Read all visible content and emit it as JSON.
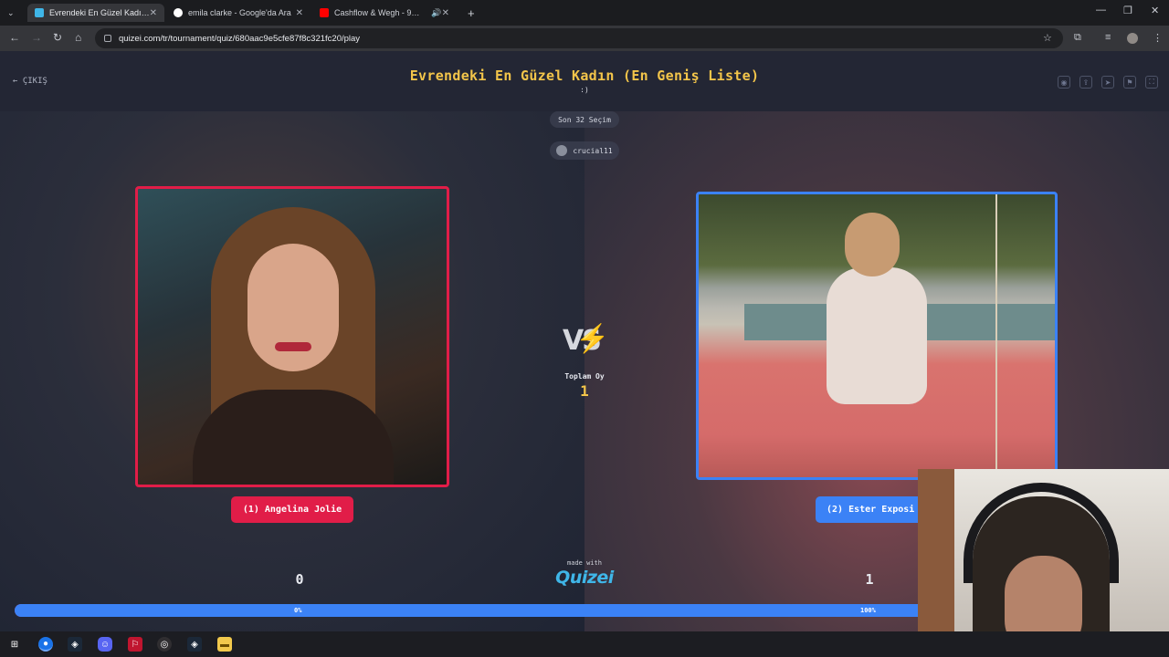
{
  "browser": {
    "tabs": [
      {
        "label": "Evrendeki En Güzel Kadın (En G",
        "favicon_color": "#3fb6e8",
        "active": true
      },
      {
        "label": "emila clarke - Google'da Ara",
        "favicon_color": "#ffffff",
        "active": false
      },
      {
        "label": "Cashflow & Wegh - 9mm (",
        "favicon_color": "#ff0000",
        "active": false
      }
    ],
    "new_tab": "+",
    "url": "quizei.com/tr/tournament/quiz/680aac9e5cfe87f8c321fc20/play"
  },
  "header": {
    "exit_label": "← ÇIKIŞ",
    "title": "Evrendeki En Güzel Kadın (En Geniş Liste)",
    "subtitle": ":)",
    "icons": [
      "eye-icon",
      "share-icon",
      "send-icon",
      "flag-icon",
      "fullscreen-icon"
    ]
  },
  "round": {
    "label": "Son 32 Seçim",
    "username": "crucial11"
  },
  "left": {
    "name": "(1) Angelina Jolie",
    "score": "0",
    "percent": "0%",
    "color": "#e11d48"
  },
  "right": {
    "name": "(2) Ester Exposi",
    "score": "1",
    "percent": "100%",
    "color": "#3b82f6"
  },
  "center": {
    "vs": "VS",
    "total_label": "Toplam Oy",
    "total_value": "1",
    "made_with": "made with",
    "logo": "Quizei"
  },
  "progress": {
    "right_share": 1.0
  },
  "taskbar": {
    "items": [
      "windows-start-icon",
      "chrome-icon",
      "steam-icon",
      "discord-icon",
      "app-icon",
      "obs-icon",
      "steam-icon-2",
      "file-explorer-icon"
    ]
  }
}
